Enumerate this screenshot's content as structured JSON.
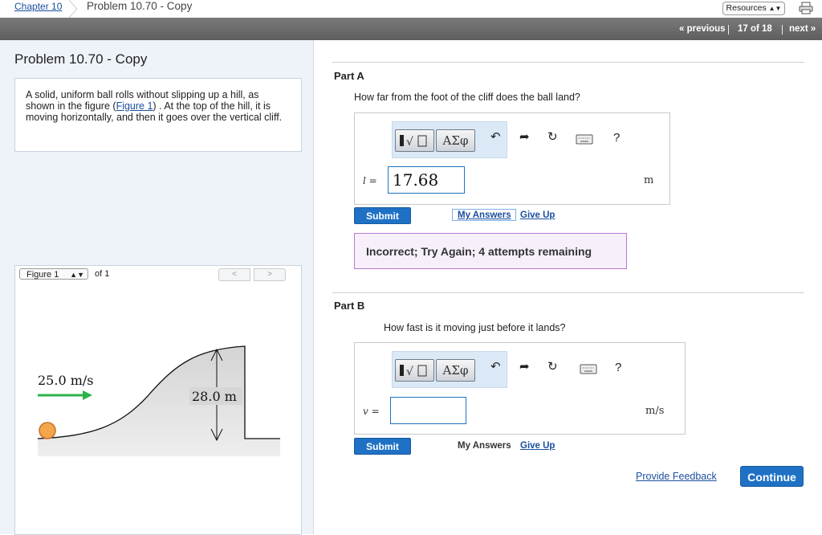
{
  "breadcrumb": {
    "chapter": "Chapter 10",
    "title": "Problem 10.70 - Copy"
  },
  "header": {
    "resources_label": "Resources"
  },
  "nav": {
    "previous": "« previous",
    "position": "17 of 18",
    "next": "next »"
  },
  "problem": {
    "title": "Problem 10.70 - Copy",
    "text_before_link": "A solid, uniform ball rolls without slipping up a hill, as shown in the figure (",
    "link": "Figure 1",
    "text_after_link": ") . At the top of the hill, it is moving horizontally, and then it goes over the vertical cliff."
  },
  "figure": {
    "selector": "Figure 1",
    "of": "of 1",
    "prev": "<",
    "next": ">",
    "speed_label": "25.0 m/s",
    "height_label": "28.0 m"
  },
  "toolbar": {
    "greek": "ΑΣφ",
    "help": "?"
  },
  "part_a": {
    "title": "Part A",
    "question": "How far from the foot of the cliff does the ball land?",
    "var_label": "l =",
    "value": "17.68",
    "unit": "m",
    "submit": "Submit",
    "my_answers": "My Answers",
    "give_up": "Give Up",
    "feedback": "Incorrect; Try Again; 4 attempts remaining"
  },
  "part_b": {
    "title": "Part B",
    "question": "How fast is it moving just before it lands?",
    "var_label": "v =",
    "value": "",
    "unit": "m/s",
    "submit": "Submit",
    "my_answers": "My Answers",
    "give_up": "Give Up"
  },
  "footer": {
    "provide_feedback": "Provide Feedback",
    "continue": "Continue"
  },
  "colors": {
    "accent": "#1f71c5",
    "arrow": "#2bb34a",
    "ball": "#f4a64b"
  }
}
